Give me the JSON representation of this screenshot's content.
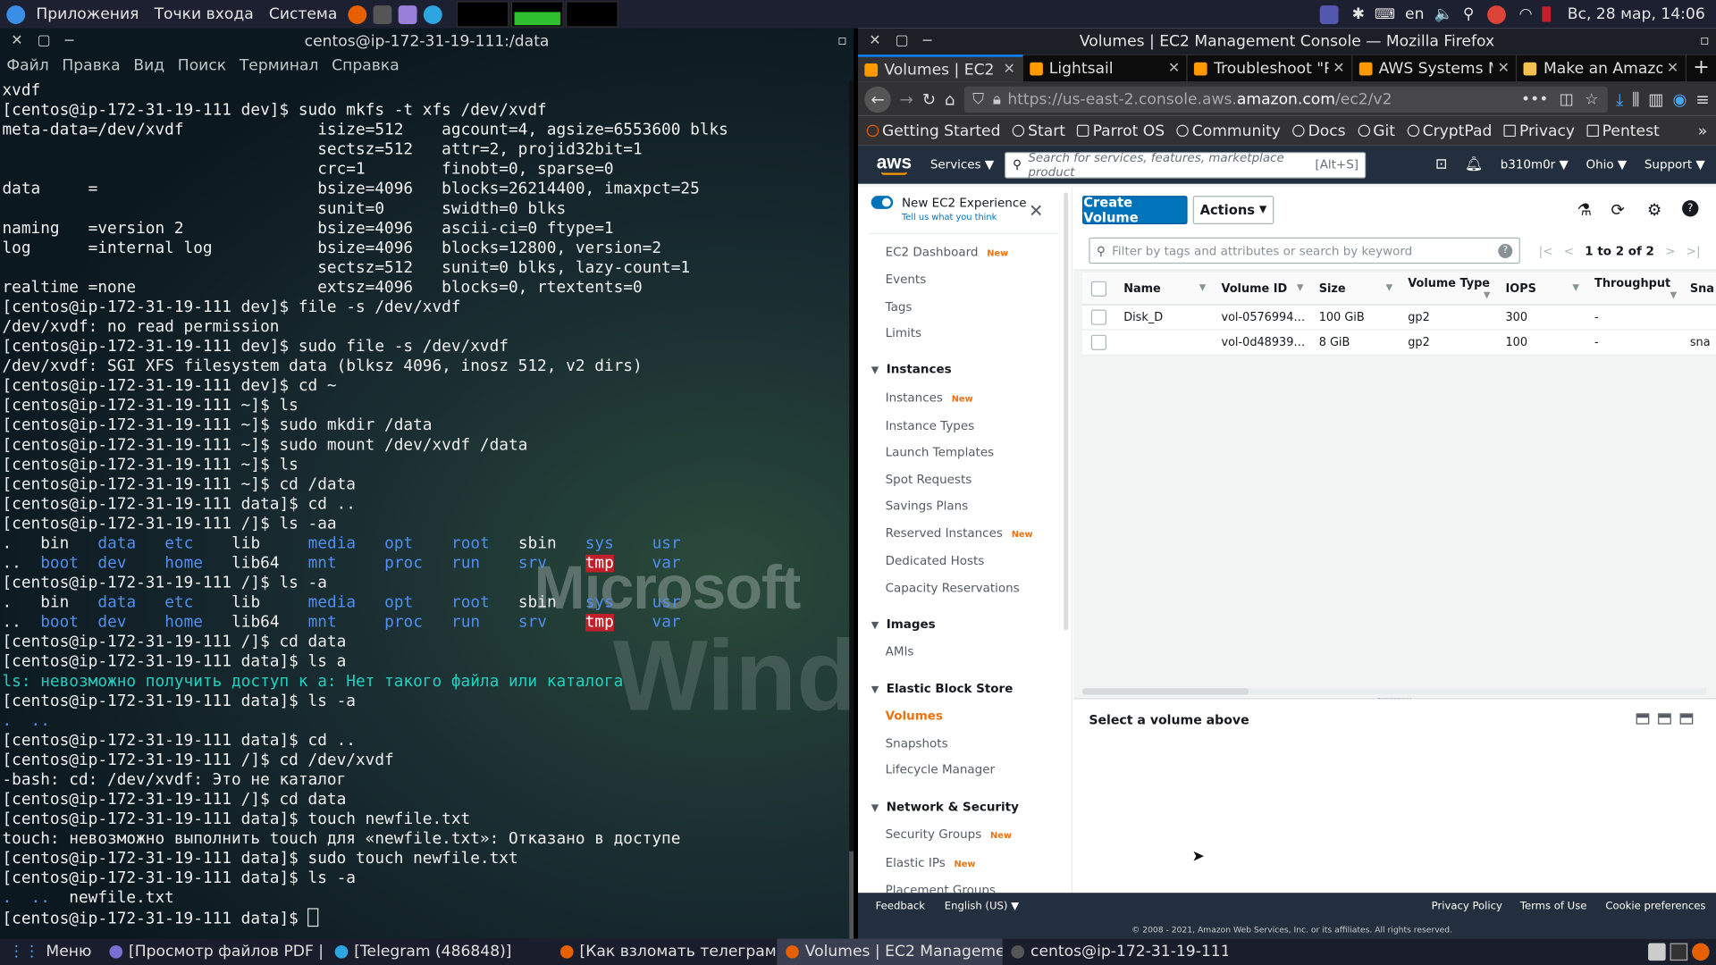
{
  "top_panel": {
    "menu_apps": "Приложения",
    "menu_places": "Точки входа",
    "menu_system": "Система",
    "lang": "en",
    "datetime": "Вс, 28 мар, 14:06"
  },
  "terminal": {
    "title": "centos@ip-172-31-19-111:/data",
    "menu": [
      "Файл",
      "Правка",
      "Вид",
      "Поиск",
      "Терминал",
      "Справка"
    ],
    "lines": [
      "xvdf",
      "[centos@ip-172-31-19-111 dev]$ sudo mkfs -t xfs /dev/xvdf",
      "meta-data=/dev/xvdf              isize=512    agcount=4, agsize=6553600 blks",
      "                                 sectsz=512   attr=2, projid32bit=1",
      "                                 crc=1        finobt=0, sparse=0",
      "data     =                       bsize=4096   blocks=26214400, imaxpct=25",
      "                                 sunit=0      swidth=0 blks",
      "naming   =version 2              bsize=4096   ascii-ci=0 ftype=1",
      "log      =internal log           bsize=4096   blocks=12800, version=2",
      "                                 sectsz=512   sunit=0 blks, lazy-count=1",
      "realtime =none                   extsz=4096   blocks=0, rtextents=0",
      "[centos@ip-172-31-19-111 dev]$ file -s /dev/xvdf",
      "/dev/xvdf: no read permission",
      "[centos@ip-172-31-19-111 dev]$ sudo file -s /dev/xvdf",
      "/dev/xvdf: SGI XFS filesystem data (blksz 4096, inosz 512, v2 dirs)",
      "[centos@ip-172-31-19-111 dev]$ cd ~",
      "[centos@ip-172-31-19-111 ~]$ ls",
      "[centos@ip-172-31-19-111 ~]$ sudo mkdir /data",
      "[centos@ip-172-31-19-111 ~]$ sudo mount /dev/xvdf /data",
      "[centos@ip-172-31-19-111 ~]$ ls",
      "[centos@ip-172-31-19-111 ~]$ cd /data",
      "[centos@ip-172-31-19-111 data]$ cd ..",
      "[centos@ip-172-31-19-111 /]$ ls -aa",
      "[[ls1a]]",
      "[[ls1b]]",
      "[centos@ip-172-31-19-111 /]$ ls -a",
      "[[ls1a]]",
      "[[ls1b]]",
      "[centos@ip-172-31-19-111 /]$ cd data",
      "[centos@ip-172-31-19-111 data]$ ls a",
      "ls: невозможно получить доступ к a: Нет такого файла или каталога",
      "[centos@ip-172-31-19-111 data]$ ls -a",
      "[[dots]]",
      "[centos@ip-172-31-19-111 data]$ cd ..",
      "[centos@ip-172-31-19-111 /]$ cd /dev/xvdf",
      "-bash: cd: /dev/xvdf: Это не каталог",
      "[centos@ip-172-31-19-111 /]$ cd data",
      "[centos@ip-172-31-19-111 data]$ touch newfile.txt",
      "touch: невозможно выполнить touch для «newfile.txt»: Отказано в доступе",
      "[centos@ip-172-31-19-111 data]$ sudo touch newfile.txt",
      "[centos@ip-172-31-19-111 data]$ ls -a",
      "[[newfile]]",
      "[centos@ip-172-31-19-111 data]$ "
    ],
    "ls_row1": [
      ". ",
      "bin",
      "data",
      "etc",
      "lib",
      "media",
      "opt",
      "root",
      "sbin",
      "sys",
      "usr"
    ],
    "ls_row2": [
      "..",
      "boot",
      "dev",
      "home",
      "lib64",
      "mnt",
      "proc",
      "run",
      "srv",
      "tmp",
      "var"
    ],
    "dots": ".  ..",
    "newfile_line": ".  ..  newfile.txt",
    "watermark": "Microsoft",
    "watermark2": "Wind"
  },
  "firefox": {
    "title": "Volumes | EC2 Management Console — Mozilla Firefox",
    "tabs": [
      {
        "label": "Volumes | EC2 M",
        "active": true
      },
      {
        "label": "Lightsail",
        "active": false
      },
      {
        "label": "Troubleshoot \"P",
        "active": false
      },
      {
        "label": "AWS Systems M",
        "active": false
      },
      {
        "label": "Make an Amazo",
        "active": false
      }
    ],
    "url_pre": "https://us-east-2.console.aws.",
    "url_host": "amazon.com",
    "url_post": "/ec2/v2",
    "bookmarks": [
      "Getting Started",
      "Start",
      "Parrot OS",
      "Community",
      "Docs",
      "Git",
      "CryptPad",
      "Privacy",
      "Pentest"
    ]
  },
  "aws": {
    "logo": "aws",
    "services": "Services",
    "search_placeholder": "Search for services, features, marketplace product",
    "search_shortcut": "[Alt+S]",
    "user": "b310m0r",
    "region": "Ohio",
    "support": "Support",
    "new_experience": "New EC2 Experience",
    "tell_us": "Tell us what you think",
    "nav": {
      "dashboard": "EC2 Dashboard",
      "events": "Events",
      "tags": "Tags",
      "limits": "Limits",
      "instances_h": "Instances",
      "instances": "Instances",
      "instance_types": "Instance Types",
      "launch_templates": "Launch Templates",
      "spot": "Spot Requests",
      "savings": "Savings Plans",
      "reserved": "Reserved Instances",
      "dedicated": "Dedicated Hosts",
      "capacity": "Capacity Reservations",
      "images_h": "Images",
      "amis": "AMIs",
      "ebs_h": "Elastic Block Store",
      "volumes": "Volumes",
      "snapshots": "Snapshots",
      "lifecycle": "Lifecycle Manager",
      "netsec_h": "Network & Security",
      "security_groups": "Security Groups",
      "elastic_ips": "Elastic IPs",
      "placement": "Placement Groups",
      "new_badge": "New"
    },
    "create_volume": "Create Volume",
    "actions": "Actions",
    "filter_placeholder": "Filter by tags and attributes or search by keyword",
    "pager": "1 to 2 of 2",
    "columns": [
      "Name",
      "Volume ID",
      "Size",
      "Volume Type",
      "IOPS",
      "Throughput",
      "Sna"
    ],
    "rows": [
      [
        "Disk_D",
        "vol-0576994…",
        "100 GiB",
        "gp2",
        "300",
        "-",
        ""
      ],
      [
        "",
        "vol-0d48939…",
        "8 GiB",
        "gp2",
        "100",
        "-",
        "sna"
      ]
    ],
    "detail": "Select a volume above",
    "footer": {
      "feedback": "Feedback",
      "language": "English (US)",
      "privacy": "Privacy Policy",
      "terms": "Terms of Use",
      "cookies": "Cookie preferences",
      "copyright": "© 2008 - 2021, Amazon Web Services, Inc. or its affiliates. All rights reserved."
    }
  },
  "taskbar": {
    "menu": "Меню",
    "items": [
      "[Просмотр файлов PDF | ...",
      "[Telegram (486848)]",
      "[Как взломать телеграмм ...",
      "Volumes | EC2 Manageme...",
      "centos@ip-172-31-19-111:..."
    ]
  }
}
